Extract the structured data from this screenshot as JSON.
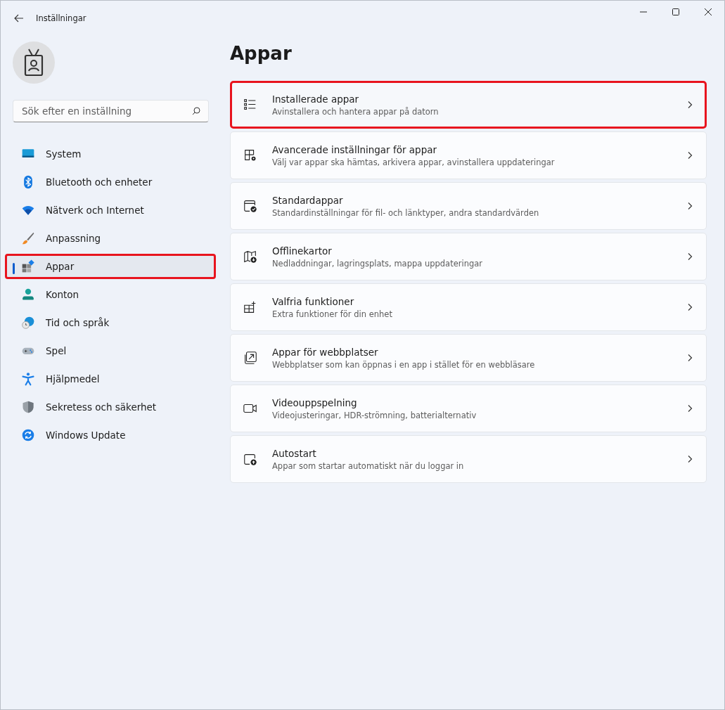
{
  "window": {
    "title": "Inställningar"
  },
  "search": {
    "placeholder": "Sök efter en inställning"
  },
  "sidebar": {
    "items": [
      {
        "label": "System",
        "selected": false,
        "highlighted": false
      },
      {
        "label": "Bluetooth och enheter",
        "selected": false,
        "highlighted": false
      },
      {
        "label": "Nätverk och Internet",
        "selected": false,
        "highlighted": false
      },
      {
        "label": "Anpassning",
        "selected": false,
        "highlighted": false
      },
      {
        "label": "Appar",
        "selected": true,
        "highlighted": true
      },
      {
        "label": "Konton",
        "selected": false,
        "highlighted": false
      },
      {
        "label": "Tid och språk",
        "selected": false,
        "highlighted": false
      },
      {
        "label": "Spel",
        "selected": false,
        "highlighted": false
      },
      {
        "label": "Hjälpmedel",
        "selected": false,
        "highlighted": false
      },
      {
        "label": "Sekretess och säkerhet",
        "selected": false,
        "highlighted": false
      },
      {
        "label": "Windows Update",
        "selected": false,
        "highlighted": false
      }
    ]
  },
  "page": {
    "title": "Appar",
    "cards": [
      {
        "title": "Installerade appar",
        "description": "Avinstallera och hantera appar på datorn",
        "highlighted": true
      },
      {
        "title": "Avancerade inställningar för appar",
        "description": "Välj var appar ska hämtas, arkivera appar, avinstallera uppdateringar",
        "highlighted": false
      },
      {
        "title": "Standardappar",
        "description": "Standardinställningar för fil- och länktyper, andra standardvärden",
        "highlighted": false
      },
      {
        "title": "Offlinekartor",
        "description": "Nedladdningar, lagringsplats, mappa uppdateringar",
        "highlighted": false
      },
      {
        "title": "Valfria funktioner",
        "description": "Extra funktioner för din enhet",
        "highlighted": false
      },
      {
        "title": "Appar för webbplatser",
        "description": "Webbplatser som kan öppnas i en app i stället för en webbläsare",
        "highlighted": false
      },
      {
        "title": "Videouppspelning",
        "description": "Videojusteringar, HDR-strömning, batterialternativ",
        "highlighted": false
      },
      {
        "title": "Autostart",
        "description": "Appar som startar automatiskt när du loggar in",
        "highlighted": false
      }
    ]
  }
}
